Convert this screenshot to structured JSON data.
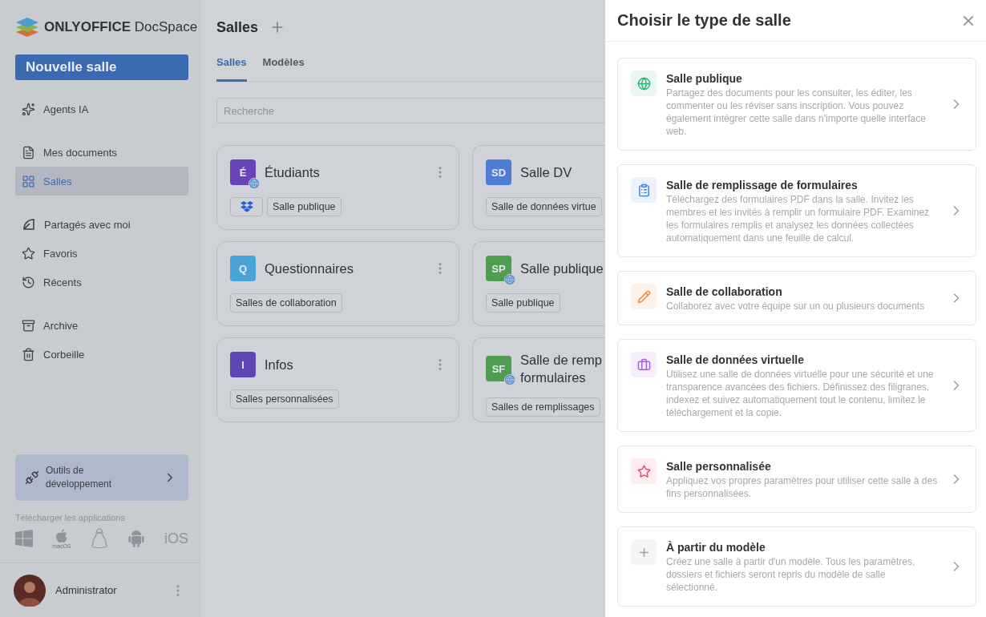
{
  "brand": {
    "name": "ONLYOFFICE",
    "product": "DocSpace"
  },
  "sidebar": {
    "new_button": "Nouvelle salle",
    "groups": [
      [
        {
          "label": "Agents IA",
          "selected": false
        }
      ],
      [
        {
          "label": "Mes documents",
          "selected": false
        },
        {
          "label": "Salles",
          "selected": true
        }
      ],
      [
        {
          "label": "Partagés avec moi",
          "selected": false
        },
        {
          "label": "Favoris",
          "selected": false
        },
        {
          "label": "Récents",
          "selected": false
        }
      ],
      [
        {
          "label": "Archive",
          "selected": false
        },
        {
          "label": "Corbeille",
          "selected": false
        }
      ]
    ],
    "dev_tools": "Outils de développement",
    "download_label": "Télécharger les applications",
    "apps": [
      {
        "kind": "windows"
      },
      {
        "kind": "macos",
        "label": "macOS"
      },
      {
        "kind": "linux"
      },
      {
        "kind": "android"
      },
      {
        "kind": "ios",
        "label": "iOS"
      }
    ],
    "user": {
      "name": "Administrator"
    }
  },
  "main": {
    "title": "Salles",
    "tabs": [
      {
        "label": "Salles",
        "selected": true
      },
      {
        "label": "Modèles",
        "selected": false
      }
    ],
    "search": {
      "placeholder": "Recherche"
    },
    "rooms": [
      {
        "initials": "É",
        "title": "Étudiants",
        "color": "#6a45b8",
        "public": true,
        "tags": [
          {
            "kind": "dropbox"
          },
          {
            "kind": "text",
            "label": "Salle publique"
          }
        ]
      },
      {
        "initials": "SD",
        "title": "Salle DV",
        "color": "#4f7cd4",
        "public": false,
        "tags": [
          {
            "kind": "text",
            "label": "Salle de données virtue"
          }
        ]
      },
      {
        "initials": "Q",
        "title": "Questionnaires",
        "color": "#4aa3d6",
        "public": false,
        "tags": [
          {
            "kind": "text",
            "label": "Salles de collaboration"
          }
        ]
      },
      {
        "initials": "SP",
        "title": "Salle publique",
        "color": "#4f9e4f",
        "public": true,
        "tags": [
          {
            "kind": "text",
            "label": "Salle publique"
          }
        ]
      },
      {
        "initials": "I",
        "title": "Infos",
        "color": "#6046b5",
        "public": false,
        "tags": [
          {
            "kind": "text",
            "label": "Salles personnalisées"
          }
        ]
      },
      {
        "initials": "SF",
        "title": "Salle de remp formulaires",
        "color": "#4f9e4f",
        "public": true,
        "tags": [
          {
            "kind": "text",
            "label": "Salles de remplissages"
          }
        ]
      }
    ]
  },
  "panel": {
    "title": "Choisir le type de salle",
    "options": [
      {
        "kind": "public",
        "color": "#22b573",
        "title": "Salle publique",
        "description": "Partagez des documents pour les consulter, les éditer, les commenter ou les réviser sans inscription. Vous pouvez également intégrer cette salle dans n'importe quelle interface web."
      },
      {
        "kind": "form",
        "color": "#3b82d6",
        "title": "Salle de remplissage de formulaires",
        "description": "Téléchargez des formulaires PDF dans la salle. Invitez les membres et les invités à remplir un formulaire PDF. Examinez les formulaires remplis et analysez les données collectées automatiquement dans une feuille de calcul."
      },
      {
        "kind": "collaboration",
        "color": "#ee8a2e",
        "title": "Salle de collaboration",
        "description": "Collaborez avec votre équipe sur un ou plusieurs documents"
      },
      {
        "kind": "virtual",
        "color": "#a35ce8",
        "title": "Salle de données virtuelle",
        "description": "Utilisez une salle de données virtuelle pour une sécurité et une transparence avancées des fichiers. Définissez des filigranes, indexez et suivez automatiquement tout le contenu, limitez le téléchargement et la copie."
      },
      {
        "kind": "custom",
        "color": "#e8456a",
        "title": "Salle personnalisée",
        "description": "Appliquez vos propres paramètres pour utiliser cette salle à des fins personnalisées."
      },
      {
        "kind": "template",
        "color": "#9aa0a6",
        "title": "À partir du modèle",
        "description": "Créez une salle à partir d'un modèle. Tous les paramètres, dossiers et fichiers seront repris du modèle de salle sélectionné."
      }
    ]
  }
}
